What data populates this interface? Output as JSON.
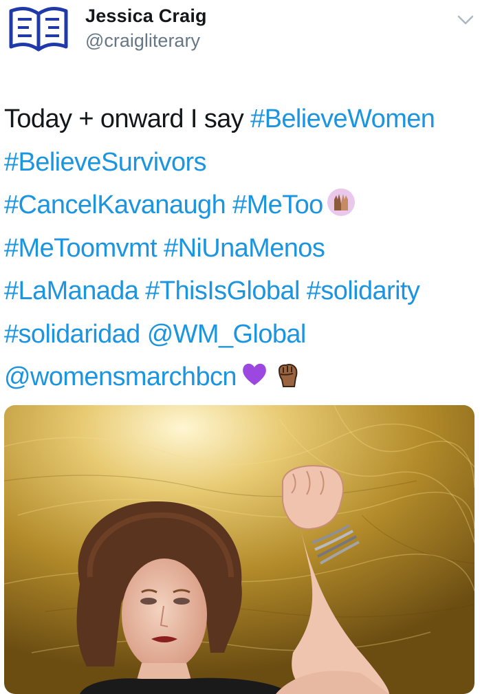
{
  "user": {
    "name": "Jessica Craig",
    "handle": "@craigliterary",
    "avatar_icon": "open-book-icon"
  },
  "menu": {
    "icon": "chevron-down-icon"
  },
  "tweet": {
    "lines": [
      [
        {
          "t": "Today + onward I say "
        },
        {
          "t": "#BelieveWomen",
          "link": true
        }
      ],
      [
        {
          "t": "#BelieveSurvivors",
          "link": true
        }
      ],
      [
        {
          "t": "#CancelKavanaugh",
          "link": true
        },
        {
          "t": " "
        },
        {
          "t": "#MeToo",
          "link": true
        }
      ],
      [
        {
          "t": "#MeToomvmt",
          "link": true
        },
        {
          "t": " "
        },
        {
          "t": "#NiUnaMenos",
          "link": true
        }
      ],
      [
        {
          "t": "#LaManada",
          "link": true
        },
        {
          "t": " "
        },
        {
          "t": "#ThisIsGlobal",
          "link": true
        },
        {
          "t": " "
        },
        {
          "t": "#solidarity",
          "link": true
        }
      ],
      [
        {
          "t": "#solidaridad",
          "link": true
        },
        {
          "t": " "
        },
        {
          "t": "@WM_Global",
          "link": true
        }
      ],
      [
        {
          "t": "@womensmarchbcn",
          "link": true
        }
      ]
    ],
    "emojis": {
      "line3": [
        "raised-hands-icon"
      ],
      "line7": [
        "purple-heart-icon",
        "raised-fist-icon"
      ]
    }
  },
  "media": {
    "description_icon": "woman-raised-fist-photo"
  },
  "colors": {
    "link": "#1b95e0",
    "text": "#14171a",
    "secondary": "#657786",
    "avatar_blue": "#1f3aa8",
    "purple_heart": "#9b47e0",
    "gold": "#c8a435"
  }
}
